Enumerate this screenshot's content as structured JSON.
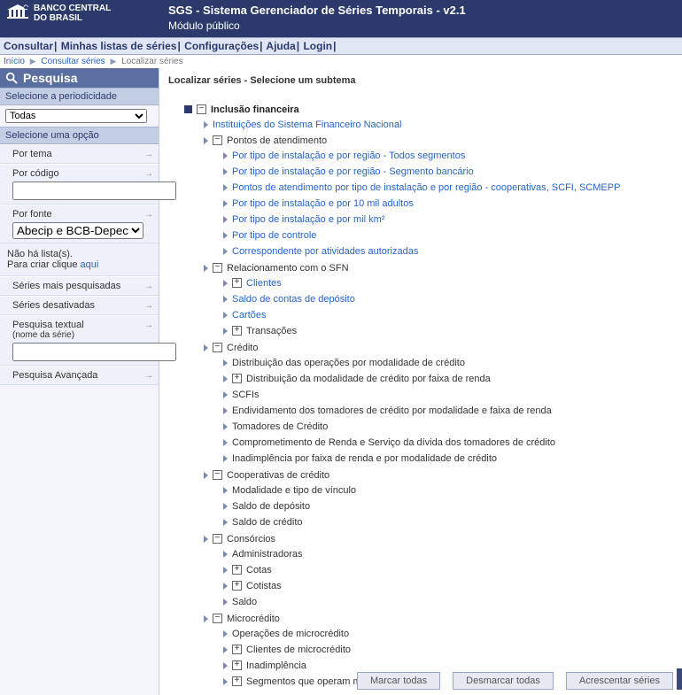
{
  "header": {
    "logo_line1": "BANCO CENTRAL",
    "logo_line2": "DO BRASIL",
    "title": "SGS - Sistema Gerenciador de Séries Temporais - v2.1",
    "subtitle": "Módulo público"
  },
  "menubar": [
    "Consultar",
    "Minhas listas de séries",
    "Configurações",
    "Ajuda",
    "Login"
  ],
  "breadcrumb": {
    "home": "Início",
    "consultar": "Consultar séries",
    "localizar": "Localizar séries"
  },
  "sidebar": {
    "search_title": "Pesquisa",
    "periodicidade_label": "Selecione a periodicidade",
    "periodicidade_value": "Todas",
    "opcao_label": "Selecione uma opção",
    "por_tema": "Por tema",
    "por_codigo": "Por código",
    "por_codigo_value": "",
    "por_fonte": "Por fonte",
    "por_fonte_value": "Abecip e BCB-Depec",
    "nota_1": "Não há lista(s).",
    "nota_2a": "Para criar clique ",
    "nota_2b": "aqui",
    "mais_pesq": "Séries mais pesquisadas",
    "desativadas": "Séries desativadas",
    "textual_1": "Pesquisa textual",
    "textual_2": "(nome da série)",
    "textual_value": "",
    "avancada": "Pesquisa Avançada"
  },
  "main": {
    "title": "Localizar séries - Selecione um subtema",
    "root": "Inclusão financeira",
    "instituicoes": "Instituições do Sistema Financeiro Nacional",
    "pontos": {
      "label": "Pontos de atendimento",
      "items": [
        "Por tipo de instalação e por região - Todos segmentos",
        "Por tipo de instalação e por região - Segmento bancário",
        "Pontos de atendimento por tipo de instalação e por região - cooperativas, SCFI, SCMEPP",
        "Por tipo de instalação e por 10 mil adultos",
        "Por tipo de instalação e por mil km²",
        "Por tipo de controle",
        "Correspondente por atividades autorizadas"
      ]
    },
    "sfn": {
      "label": "Relacionamento com o SFN",
      "clientes": "Clientes",
      "saldo": "Saldo de contas de depósito",
      "cartoes": "Cartões",
      "trans": "Transações"
    },
    "credito": {
      "label": "Crédito",
      "distrib": "Distribuição das operações por modalidade de crédito",
      "faixa": "Distribuição da modalidade de crédito por faixa de renda",
      "scfis": "SCFIs",
      "endiv": "Endividamento dos tomadores de crédito por modalidade e faixa de renda",
      "tomadores": "Tomadores de Crédito",
      "compr": "Comprometimento de Renda e Serviço da dívida dos tomadores de crédito",
      "inad": "Inadimplência por faixa de renda e por modalidade de crédito"
    },
    "coop": {
      "label": "Cooperativas de crédito",
      "modalidade": "Modalidade e tipo de vínculo",
      "saldo_dep": "Saldo de depósito",
      "saldo_cred": "Saldo de crédito"
    },
    "cons": {
      "label": "Consórcios",
      "admin": "Administradoras",
      "cotas": "Cotas",
      "cotistas": "Cotistas",
      "saldo": "Saldo"
    },
    "micro": {
      "label": "Microcrédito",
      "op": "Operações de microcrédito",
      "clientes": "Clientes de microcrédito",
      "inad": "Inadimplência",
      "seg": "Segmentos que operam microcrédito"
    }
  },
  "buttons": {
    "marcar": "Marcar todas",
    "desmarcar": "Desmarcar todas",
    "acrescentar": "Acrescentar séries"
  }
}
